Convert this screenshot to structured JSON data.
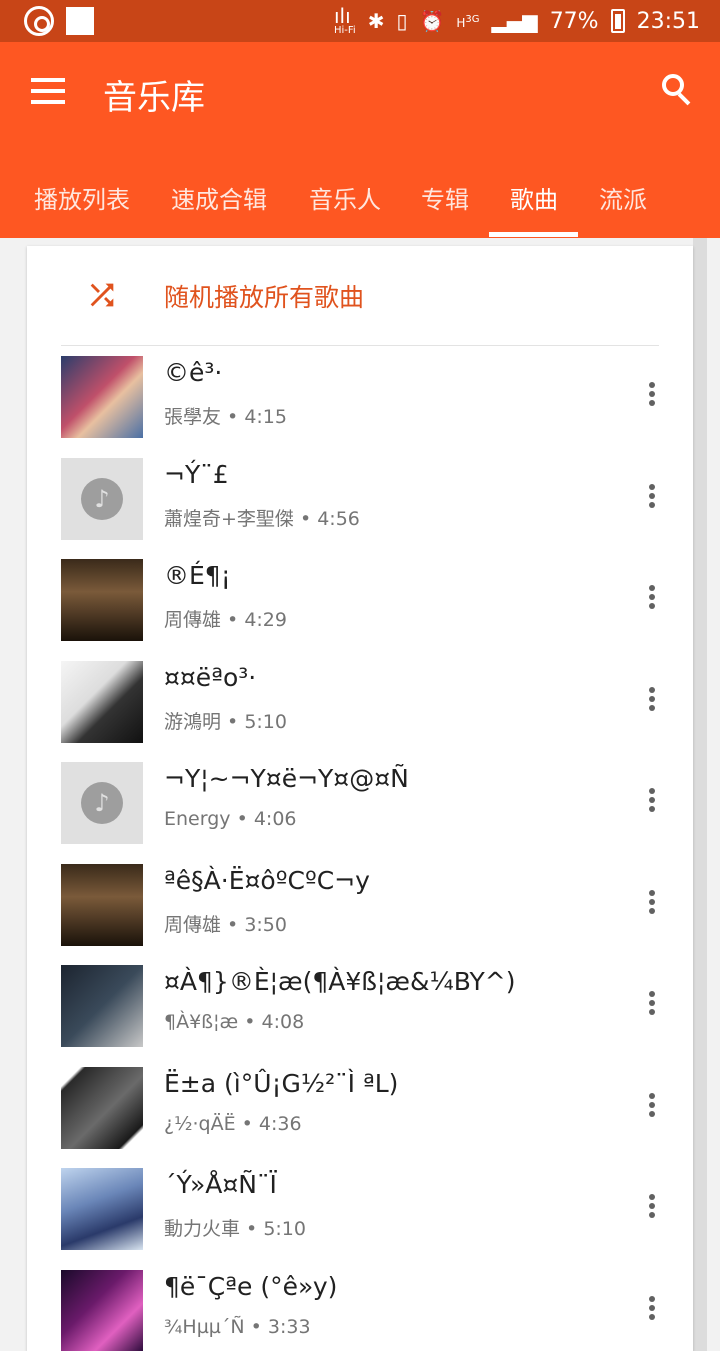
{
  "status_bar": {
    "network_icon": "hifi-signal-icon",
    "network_label": "Hi-Fi",
    "mobile_badge": "H",
    "mobile_type": "3G",
    "battery_percent": "77%",
    "time": "23:51"
  },
  "header": {
    "title": "音乐库"
  },
  "tabs": [
    {
      "label": "播放列表",
      "active": false
    },
    {
      "label": "速成合辑",
      "active": false
    },
    {
      "label": "音乐人",
      "active": false
    },
    {
      "label": "专辑",
      "active": false
    },
    {
      "label": "歌曲",
      "active": true
    },
    {
      "label": "流派",
      "active": false
    }
  ],
  "shuffle": {
    "label": "随机播放所有歌曲",
    "icon": "shuffle-icon",
    "color": "#e0531e"
  },
  "songs": [
    {
      "title": "©ê³·",
      "artist": "張學友",
      "duration": "4:15",
      "art": "album-art-1"
    },
    {
      "title": "¬Ý¨£",
      "artist": "蕭煌奇+李聖傑",
      "duration": "4:56",
      "art": "placeholder"
    },
    {
      "title": "®É¶¡",
      "artist": "周傳雄",
      "duration": "4:29",
      "art": "album-art-transfer"
    },
    {
      "title": "¤¤ëªo³·",
      "artist": "游鴻明",
      "duration": "5:10",
      "art": "album-art-4"
    },
    {
      "title": "¬Y¦~¬Y¤ë¬Y¤@¤Ñ",
      "artist": "Energy",
      "duration": "4:06",
      "art": "placeholder"
    },
    {
      "title": "ªê§À·Ë¤ôºCºC¬y",
      "artist": "周傳雄",
      "duration": "3:50",
      "art": "album-art-transfer"
    },
    {
      "title": "¤À¶}®È¦æ(¶À¥ß¦æ&¼BY^)",
      "artist": "¶À¥ß¦æ",
      "duration": "4:08",
      "art": "album-art-7"
    },
    {
      "title": "Ë±a (ì°Û¡G½²¨Ì ªL)",
      "artist": "¿½·qÄË",
      "duration": "4:36",
      "art": "album-art-8"
    },
    {
      "title": "´Ý»Å¤Ñ¨Ï",
      "artist": "動力火車",
      "duration": "5:10",
      "art": "album-art-9"
    },
    {
      "title": "¶ë¯Çªe (°ê»y)",
      "artist": "¾Hµµ´Ñ",
      "duration": "3:33",
      "art": "album-art-10"
    }
  ],
  "meta_separator": " • ",
  "colors": {
    "appbar": "#fe5722",
    "statusbar": "#c84517",
    "accent": "#e0531e"
  }
}
